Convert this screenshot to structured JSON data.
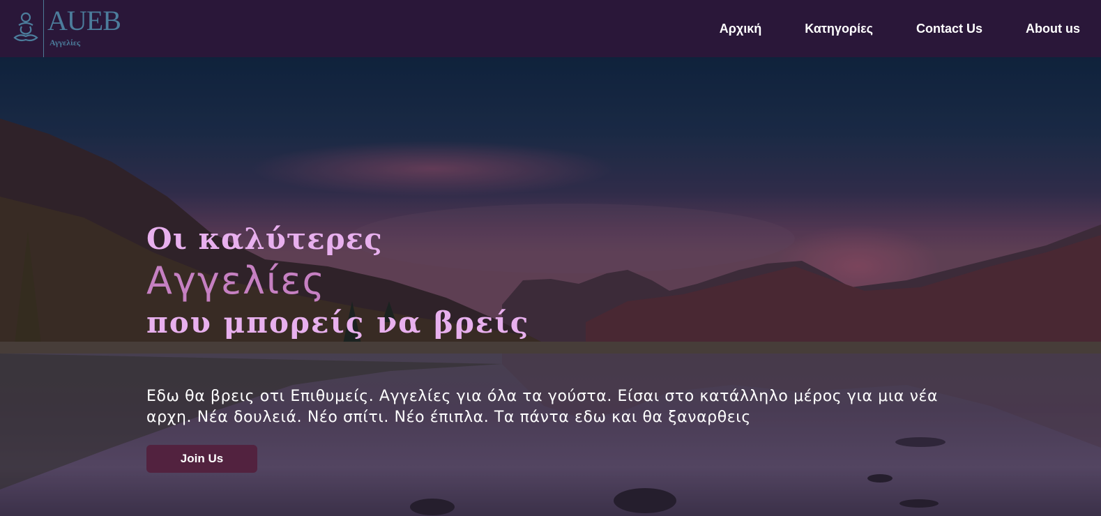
{
  "header": {
    "logo": {
      "wordmark": "AUEB",
      "subtitle": "Αγγελίες",
      "color": "#4c7d9c"
    },
    "background": "#2a1739",
    "nav": [
      {
        "label": "Αρχική"
      },
      {
        "label": "Κατηγορίες"
      },
      {
        "label": "Contact Us"
      },
      {
        "label": "About us"
      }
    ]
  },
  "hero": {
    "background_image": "mountain-lake-sunset",
    "line1": "Οι καλύτερες",
    "line2": "Αγγελίες",
    "line3": "που μπορείς να βρείς",
    "description": "Εδω θα βρεις οτι Επιθυμείς. Αγγελίες για όλα τα γούστα. Είσαι στο κατάλληλο μέρος για μια νέα αρχη. Νέα δουλειά. Νέο σπίτι. Νέο έπιπλα. Τα πάντα εδω και θα ξαναρθεις",
    "cta_label": "Join Us",
    "colors": {
      "title_light": "#e8b0ee",
      "title_accent": "#c680c2",
      "button": "#52223f"
    }
  }
}
